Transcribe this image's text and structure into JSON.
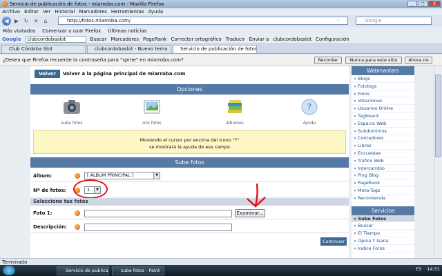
{
  "window": {
    "title": "Servicio de publicación de fotos - miarroba.com - Mozilla Firefox",
    "min": "_",
    "max": "□",
    "close": "X"
  },
  "menu": [
    "Archivo",
    "Editar",
    "Ver",
    "Historial",
    "Marcadores",
    "Herramientas",
    "Ayuda"
  ],
  "nav": {
    "url": "http://fotos.miarroba.com/",
    "search_placeholder": "Google",
    "back": "◀",
    "forward": "▶",
    "reload": "↻",
    "stop": "✕",
    "home": "⌂",
    "star": "☆"
  },
  "bookmarks": [
    "Más visitados",
    "Comenzar a usar Firefox",
    "Últimas noticias"
  ],
  "google_bar": {
    "logo": "Google",
    "query": "clubcordobaslot",
    "items": [
      "Buscar",
      "Marcadores",
      "PageRank",
      "Corrector ortográfico",
      "Traducir",
      "Enviar a",
      "clubcordobaslot",
      "Configuración"
    ]
  },
  "tabs": [
    {
      "label": "Club Córdoba Slot",
      "active": false
    },
    {
      "label": "clubcordobaslot - Nuevo tema",
      "active": false
    },
    {
      "label": "Servicio de publicación de fotos - ...",
      "active": true
    }
  ],
  "notification": {
    "text": "¿Desea que Firefox recuerde la contraseña para \"sprne\" en miarroba.com?",
    "buttons": [
      "Recordar",
      "Nunca para este sitio",
      "Ahora no"
    ]
  },
  "page": {
    "volver": "Volver",
    "volver_text": "Volver a la página principal de miarroba.com",
    "opciones_header": "Opciones",
    "options": [
      {
        "label": "sube fotos",
        "icon": "camera-icon"
      },
      {
        "label": "mis fotos",
        "icon": "photo-icon"
      },
      {
        "label": "álbumes",
        "icon": "books-icon"
      },
      {
        "label": "Ayuda",
        "icon": "help-icon"
      }
    ],
    "help_line1": "Moviendo el cursor por encima del icono \"?\"",
    "help_line2": "se mostrará la ayuda de ese campo",
    "sube_header": "Sube fotos",
    "album_label": "álbum:",
    "album_value": "[ ÁLBUM PRINCIPAL ]",
    "nfotos_label": "Nº de fotos:",
    "nfotos_value": "1",
    "selecciona": "Selecciona tus fotos",
    "foto_label": "Foto 1:",
    "examinar": "Examinar...",
    "descripcion_label": "Descripción:",
    "continuar": "Continuar"
  },
  "sidebar": {
    "webmasters_header": "Webmasters",
    "webmasters": [
      "Blogs",
      "Fotologs",
      "Foros",
      "Votaciones",
      "Usuarios Online",
      "Tagboard",
      "Espacio Web",
      "Subdominios",
      "Contadores",
      "Libros",
      "Encuestas",
      "Tráfico Web",
      "Intercambio",
      "Ping Blog",
      "PageRank",
      "Meta-Tags",
      "Recomienda"
    ],
    "servicios_header": "Servicios",
    "servicios": [
      "Sube Fotos",
      "Buscar",
      "El Tiempo",
      "Opina Y Gana",
      "Indice Foros"
    ]
  },
  "status": "Terminado",
  "taskbar": {
    "items": [
      "Servicio de publicac...",
      "sube fotos - Paint"
    ],
    "lang": "ES",
    "time": "14:51"
  },
  "colors": {
    "header_blue": "#557aa6",
    "annotation_red": "#e3141a"
  }
}
